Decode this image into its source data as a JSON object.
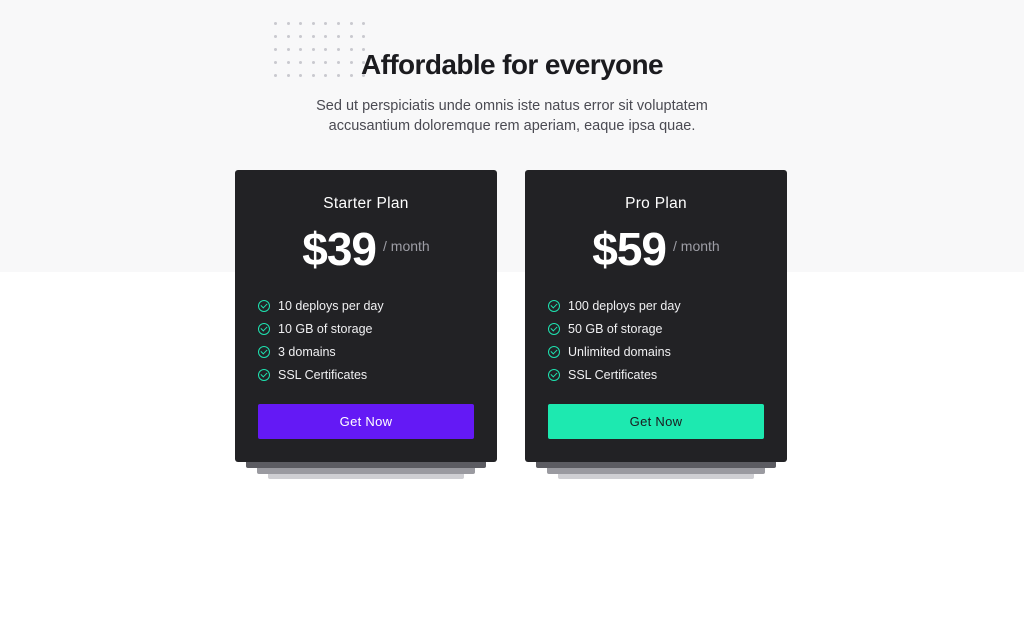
{
  "section": {
    "title": "Affordable for everyone",
    "subtitle_line1": "Sed ut perspiciatis unde omnis iste natus error sit voluptatem",
    "subtitle_line2": "accusantium doloremque rem aperiam, eaque ipsa quae."
  },
  "plans": [
    {
      "name": "Starter Plan",
      "price": "$39",
      "period": "/ month",
      "features": [
        "10 deploys per day",
        "10 GB of storage",
        "3 domains",
        "SSL Certificates"
      ],
      "cta_label": "Get Now",
      "cta_color": "#6419f5",
      "cta_text_color": "#ffffff"
    },
    {
      "name": "Pro Plan",
      "price": "$59",
      "period": "/ month",
      "features": [
        "100 deploys per day",
        "50 GB of storage",
        "Unlimited domains",
        "SSL Certificates"
      ],
      "cta_label": "Get Now",
      "cta_color": "#1de9b0",
      "cta_text_color": "#1b1b1f"
    }
  ],
  "colors": {
    "card_background": "#222225",
    "check_icon": "#1ee3b0",
    "top_band": "#f8f8f9"
  },
  "icons": {
    "feature": "check-circle-icon",
    "decoration": "dot-grid"
  }
}
